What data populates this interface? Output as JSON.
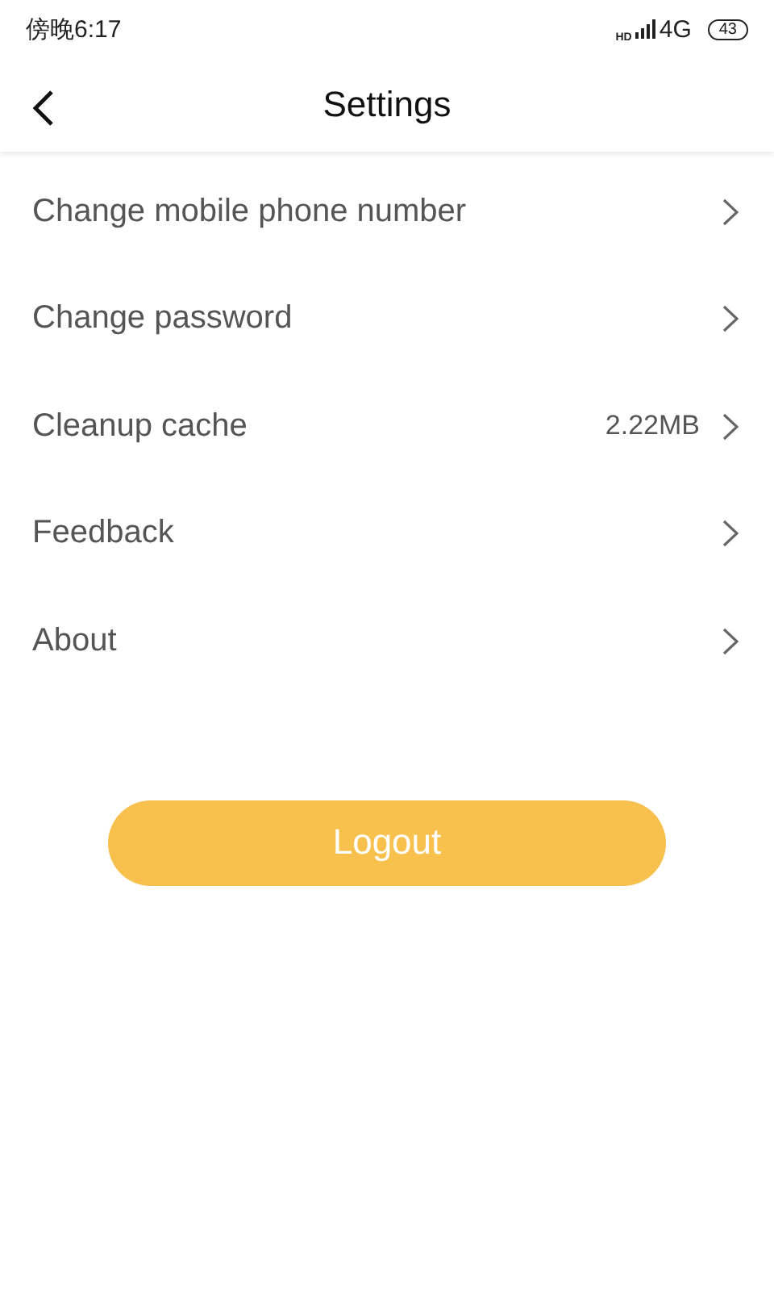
{
  "status_bar": {
    "time": "傍晚6:17",
    "hd": "HD",
    "network": "4G",
    "battery": "43"
  },
  "header": {
    "title": "Settings"
  },
  "items": [
    {
      "label": "Change mobile phone number"
    },
    {
      "label": "Change password"
    },
    {
      "label": "Cleanup cache",
      "value": "2.22MB"
    },
    {
      "label": "Feedback"
    },
    {
      "label": "About"
    }
  ],
  "logout": {
    "label": "Logout"
  }
}
